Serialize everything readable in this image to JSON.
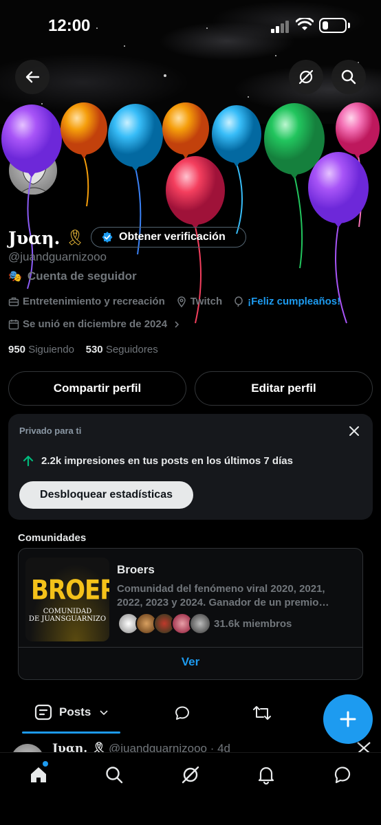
{
  "status_bar": {
    "time": "12:00"
  },
  "profile": {
    "name": "Jυαη.",
    "ribbon": "🎗",
    "verify_label": "Obtener verificación",
    "handle": "@juandguarnizooo",
    "account_type": "Cuenta de seguidor",
    "category": "Entretenimiento y recreación",
    "website": "Twitch",
    "location": "¡Feliz cumpleaños!",
    "joined": "Se unió en diciembre de 2024",
    "following_count": "950",
    "following_label": "Siguiendo",
    "followers_count": "530",
    "followers_label": "Seguidores"
  },
  "actions": {
    "share": "Compartir perfil",
    "edit": "Editar perfil"
  },
  "private_card": {
    "title": "Privado para ti",
    "impressions": "2.2k impresiones en tus posts en los últimos 7 días",
    "unlock": "Desbloquear estadísticas"
  },
  "communities": {
    "heading": "Comunidades",
    "thumb_big": "BROERS",
    "thumb_line1": "COMUNIDAD",
    "thumb_line2": "DE JUANSGUARNIZO",
    "name": "Broers",
    "description": "Comunidad del fenómeno viral 2020, 2021, 2022, 2023 y 2024. Ganador de un premio…",
    "members": "31.6k miembros",
    "see": "Ver"
  },
  "tabs": {
    "posts": "Posts"
  },
  "peek": {
    "name": "Jυαη. 🎗",
    "handle": "@juandguarnizooo · 4d"
  },
  "colors": {
    "accent": "#1d9bf0",
    "balloon_purple": "#a855f7",
    "balloon_orange": "#f59e0b",
    "balloon_blue": "#38bdf8",
    "balloon_green": "#22c55e",
    "balloon_pink": "#f472b6",
    "balloon_red": "#f43f5e"
  }
}
